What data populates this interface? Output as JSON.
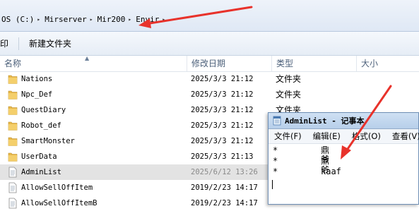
{
  "address": {
    "crumbs": [
      "OS (C:)",
      "Mirserver",
      "Mir200",
      "Envir"
    ]
  },
  "toolbar": {
    "print_label": "印",
    "new_folder_label": "新建文件夹"
  },
  "columns": {
    "name": "名称",
    "date": "修改日期",
    "type": "类型",
    "size": "大小"
  },
  "files": [
    {
      "name": "Nations",
      "date": "2025/3/3 21:12",
      "type": "文件夹",
      "icon": "folder-icon"
    },
    {
      "name": "Npc_Def",
      "date": "2025/3/3 21:12",
      "type": "文件夹",
      "icon": "folder-icon"
    },
    {
      "name": "QuestDiary",
      "date": "2025/3/3 21:12",
      "type": "文件夹",
      "icon": "folder-icon"
    },
    {
      "name": "Robot_def",
      "date": "2025/3/3 21:12",
      "type": "文件夹",
      "icon": "folder-icon"
    },
    {
      "name": "SmartMonster",
      "date": "2025/3/3 21:12",
      "type": "文件夹",
      "icon": "folder-icon"
    },
    {
      "name": "UserData",
      "date": "2025/3/3 21:13",
      "type": "文件夹",
      "icon": "folder-icon"
    },
    {
      "name": "AdminList",
      "date": "2025/6/12 13:26",
      "type": "",
      "icon": "text-file-icon",
      "selected": true
    },
    {
      "name": "AllowSellOffItem",
      "date": "2019/2/23 14:17",
      "type": "",
      "icon": "text-file-icon"
    },
    {
      "name": "AllowSellOffItemB",
      "date": "2019/2/23 14:17",
      "type": "",
      "icon": "text-file-icon"
    }
  ],
  "notepad": {
    "title": "AdminList - 记事本",
    "menu": [
      "文件(F)",
      "编辑(E)",
      "格式(O)",
      "查看(V)"
    ],
    "lines": [
      {
        "prefix": "*",
        "value": "鼎爷"
      },
      {
        "prefix": "*",
        "value": "鼎爷"
      },
      {
        "prefix": "*",
        "value": "kaaf"
      }
    ]
  },
  "colors": {
    "annotation_arrow": "#e8322b",
    "folder": "#e8b84a",
    "selected_row": "#e3e3e3"
  }
}
